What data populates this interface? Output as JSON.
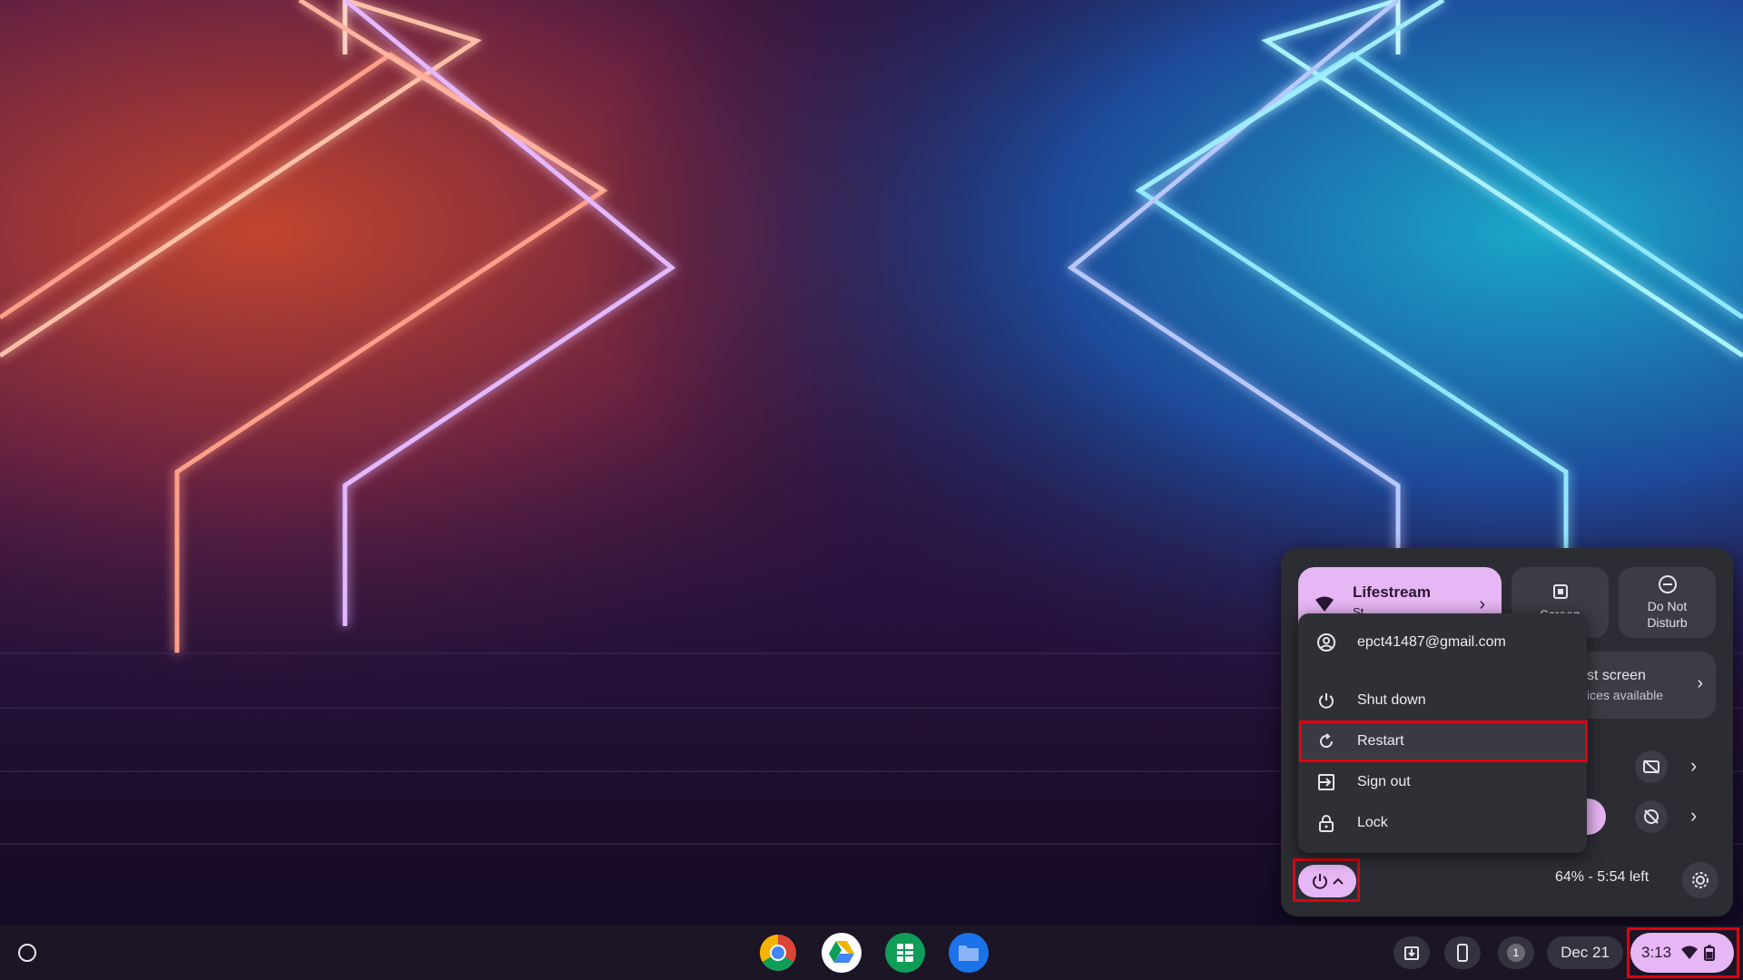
{
  "quick_settings": {
    "network_tile": {
      "title": "Lifestream",
      "subtitle": "St"
    },
    "screen_tile": {
      "label": "Screen"
    },
    "dnd_tile": {
      "label": "Do Not Disturb"
    },
    "cast_tile": {
      "title": "st screen",
      "subtitle": "ices available"
    },
    "battery_status": "64% - 5:54 left"
  },
  "power_menu": {
    "items": [
      {
        "label": "epct41487@gmail.com",
        "icon": "account-icon"
      },
      {
        "label": "Shut down",
        "icon": "power-icon"
      },
      {
        "label": "Restart",
        "icon": "restart-icon"
      },
      {
        "label": "Sign out",
        "icon": "sign-out-icon"
      },
      {
        "label": "Lock",
        "icon": "lock-icon"
      }
    ]
  },
  "shelf": {
    "apps": [
      {
        "name": "Chrome",
        "icon": "chrome-icon"
      },
      {
        "name": "Google Drive",
        "icon": "drive-icon"
      },
      {
        "name": "Google Sheets",
        "icon": "sheets-icon"
      },
      {
        "name": "Files",
        "icon": "files-icon"
      }
    ],
    "notification_count": "1",
    "date": "Dec 21",
    "time": "3:13"
  },
  "colors": {
    "accent": "#e7b6f4",
    "panel": "#2c2d33",
    "highlight": "#e0000f"
  }
}
